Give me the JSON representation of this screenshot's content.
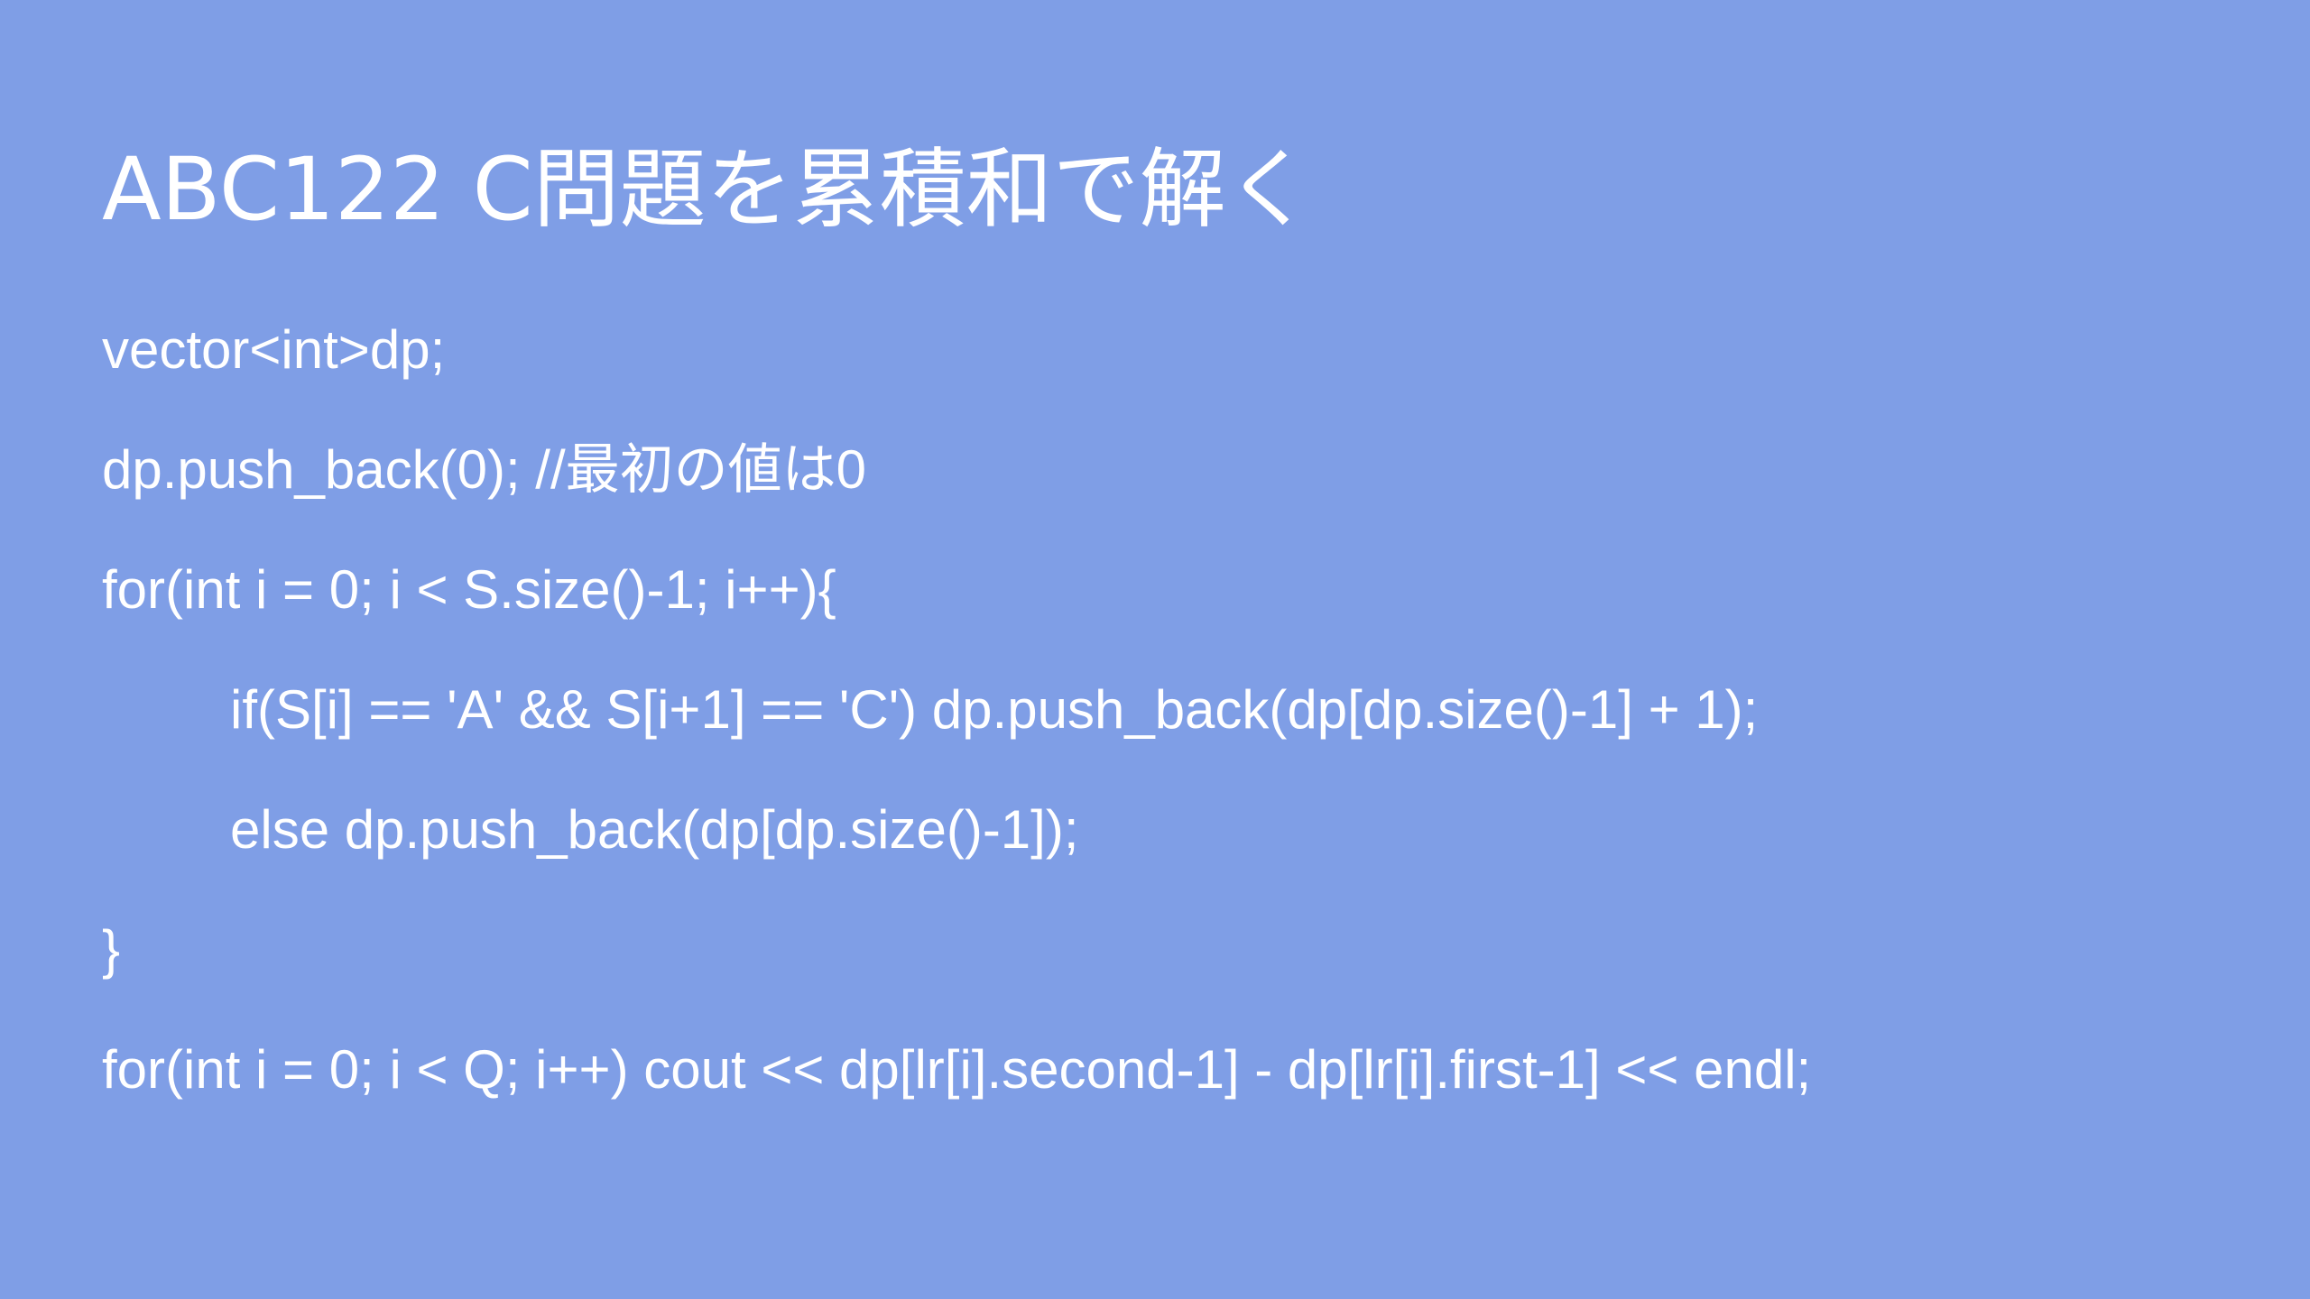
{
  "slide": {
    "title": "ABC122 C問題を累積和で解く",
    "code_lines": [
      "vector<int>dp;",
      "dp.push_back(0); //最初の値は0",
      "for(int i = 0; i < S.size()-1; i++){",
      "if(S[i] == 'A' && S[i+1] == 'C') dp.push_back(dp[dp.size()-1] + 1);",
      "else dp.push_back(dp[dp.size()-1]);",
      "}",
      "for(int i = 0; i < Q; i++) cout << dp[lr[i].second-1] - dp[lr[i].first-1] << endl;"
    ],
    "colors": {
      "background": "#7f9ee6",
      "text": "#ffffff"
    }
  }
}
